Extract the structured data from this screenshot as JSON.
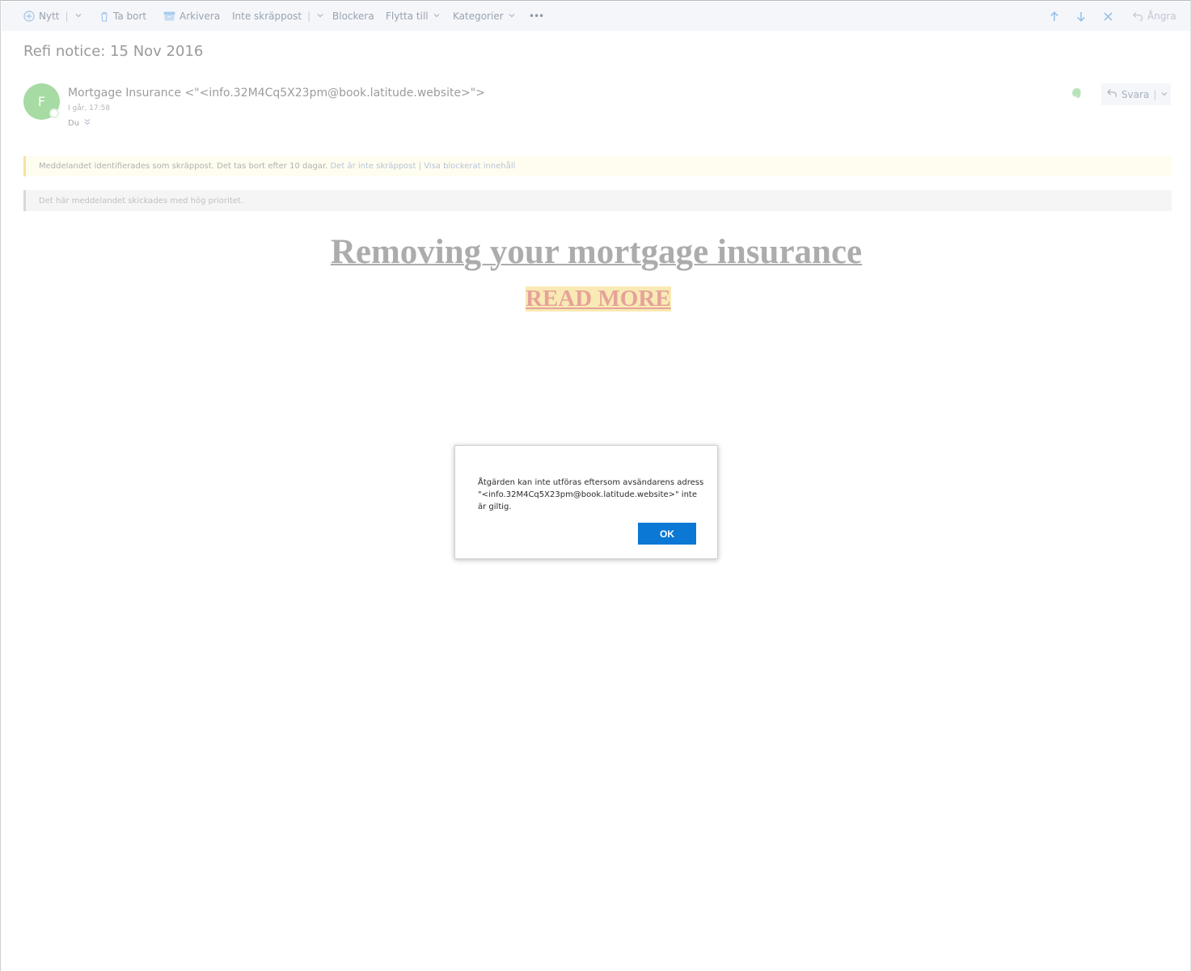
{
  "toolbar": {
    "new_label": "Nytt",
    "delete_label": "Ta bort",
    "archive_label": "Arkivera",
    "not_junk_label": "Inte skräppost",
    "block_label": "Blockera",
    "move_label": "Flytta till",
    "categories_label": "Kategorier",
    "more_label": "•••",
    "undo_label": "Ångra"
  },
  "message": {
    "subject": "Refi notice: 15 Nov 2016",
    "avatar_initial": "F",
    "sender": "Mortgage Insurance <\"<info.32M4Cq5X23pm@book.latitude.website>\">",
    "sent_time": "I går, 17:58",
    "recipient": "Du",
    "reply_label": "Svara"
  },
  "banners": {
    "junk_text": "Meddelandet identifierades som skräppost. Det tas bort efter 10 dagar.",
    "junk_link_not_junk": "Det är inte skräppost",
    "junk_link_separator": "|",
    "junk_link_show_blocked": "Visa blockerat innehåll",
    "priority_text": "Det här meddelandet skickades med hög prioritet."
  },
  "body": {
    "headline": "Removing your mortgage insurance",
    "read_more": "READ MORE"
  },
  "dialog": {
    "message": "Åtgärden kan inte utföras eftersom avsändarens adress \"<info.32M4Cq5X23pm@book.latitude.website>\" inte är giltig.",
    "ok_label": "OK"
  },
  "colors": {
    "accent": "#0a78d4",
    "avatar": "#a6dba3",
    "junk_banner": "#fffdef",
    "read_more_bg": "#f9eab4"
  }
}
